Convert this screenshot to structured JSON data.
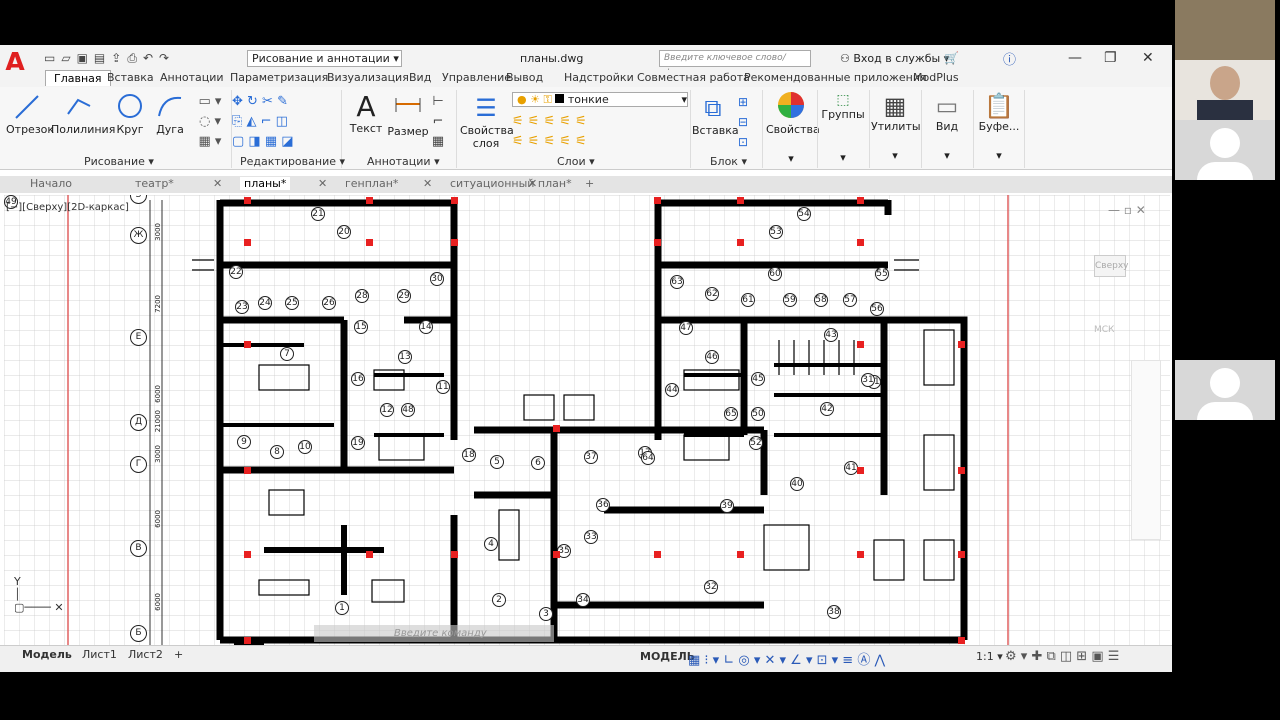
{
  "app": {
    "file_title": "планы.dwg",
    "workspace": "Рисование и аннотации",
    "search_placeholder": "Введите ключевое слово/фразу",
    "signin": "Вход в службы"
  },
  "ribbon_tabs": [
    "Главная",
    "Вставка",
    "Аннотации",
    "Параметризация",
    "Визуализация",
    "Вид",
    "Управление",
    "Вывод",
    "Надстройки",
    "Совместная работа",
    "Рекомендованные приложения",
    "ModPlus"
  ],
  "tools": {
    "line": "Отрезок",
    "polyline": "Полилиния",
    "circle": "Круг",
    "arc": "Дуга",
    "text": "Текст",
    "dimension": "Размер",
    "layer_props": "Свойства слоя",
    "layer_name": "тонкие",
    "insert": "Вставка",
    "properties": "Свойства",
    "groups": "Группы",
    "utilities": "Утилиты",
    "view": "Вид",
    "clipboard": "Буфе..."
  },
  "groups": {
    "draw": "Рисование",
    "modify": "Редактирование",
    "annot": "Аннотации",
    "layers": "Слои",
    "block": "Блок"
  },
  "doc_tabs": [
    "Начало",
    "театр*",
    "планы*",
    "генплан*",
    "ситуационный план*"
  ],
  "viewport_label": "[−][Сверху][2D-каркас]",
  "command_placeholder": "Введите команду",
  "layout_tabs": [
    "Модель",
    "Лист1",
    "Лист2"
  ],
  "status_model": "МОДЕЛЬ",
  "scale": "1:1",
  "viewcube": {
    "top": "Сверху",
    "wcs": "МСК"
  },
  "axes": [
    "З",
    "Ж",
    "Е",
    "Д",
    "Г",
    "В",
    "Б"
  ],
  "rooms": [
    "21",
    "20",
    "54",
    "53",
    "22",
    "23",
    "24",
    "25",
    "26",
    "28",
    "29",
    "30",
    "15",
    "14",
    "7",
    "13",
    "16",
    "11",
    "12",
    "48",
    "9",
    "8",
    "10",
    "19",
    "5",
    "6",
    "37",
    "18",
    "17",
    "4",
    "35",
    "33",
    "36",
    "34",
    "32",
    "2",
    "3",
    "1",
    "63",
    "62",
    "61",
    "60",
    "59",
    "58",
    "57",
    "56",
    "55",
    "47",
    "46",
    "44",
    "45",
    "43",
    "42",
    "52",
    "51",
    "41",
    "40",
    "39",
    "38",
    "31",
    "64",
    "65",
    "50",
    "49"
  ],
  "dims": [
    "3000",
    "7200",
    "6000",
    "21000",
    "3000",
    "6000",
    "6000"
  ]
}
